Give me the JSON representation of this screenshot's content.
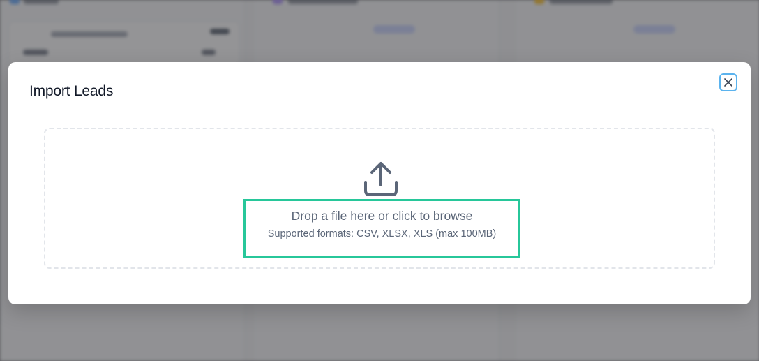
{
  "modal": {
    "title": "Import Leads",
    "close_icon": "close-icon"
  },
  "dropzone": {
    "icon": "upload-icon",
    "primary_text": "Drop a file here or click to browse",
    "secondary_text": "Supported formats: CSV, XLSX, XLS (max 100MB)"
  },
  "colors": {
    "scrim": "#3c3c40",
    "modal_bg": "#ffffff",
    "focus_ring": "#5bb3ee",
    "highlight_border": "#27c79a",
    "muted_text": "#5b6678",
    "dropzone_border": "#e2e5ea"
  }
}
